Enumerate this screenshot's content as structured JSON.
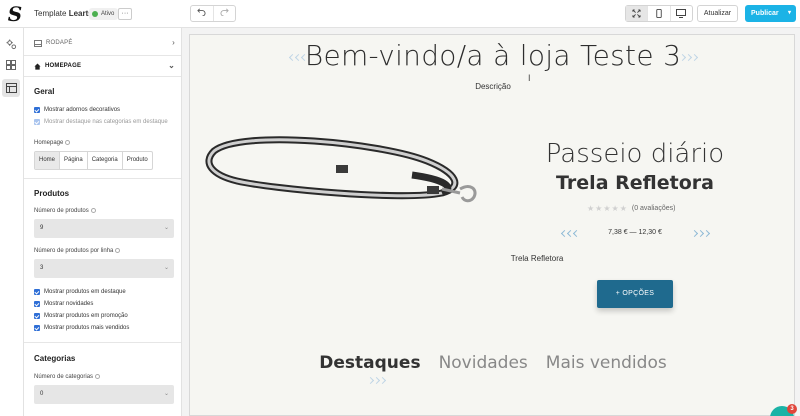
{
  "topbar": {
    "template_prefix": "Template",
    "template_name": "Learts",
    "status": "Ativo",
    "more": "···",
    "undo_icon": "undo-icon",
    "redo_icon": "redo-icon",
    "devices": [
      "fullscreen-icon",
      "mobile-icon",
      "desktop-icon"
    ],
    "update_label": "Atualizar",
    "publish_label": "Publicar",
    "publish_caret": "▾",
    "status_color": "#4caf50",
    "publish_color": "#1bb3e6"
  },
  "rail": [
    "settings-icon",
    "layout-icon",
    "sections-icon"
  ],
  "sidebar": {
    "footer_section": "Rodapé",
    "homepage_section": "Homepage",
    "geral": {
      "title": "Geral",
      "checks": [
        "Mostrar adornos decorativos",
        "Mostrar destaque nas categorias em destaque"
      ],
      "homepage_label": "Homepage",
      "homepage_options": [
        "Home",
        "Página",
        "Categoria",
        "Produto"
      ],
      "homepage_selected": "Home"
    },
    "produtos": {
      "title": "Produtos",
      "count_label": "Número de produtos",
      "count_value": "9",
      "per_line_label": "Número de produtos por linha",
      "per_line_value": "3",
      "checks": [
        "Mostrar produtos em destaque",
        "Mostrar novidades",
        "Mostrar produtos em promoção",
        "Mostrar produtos mais vendidos"
      ]
    },
    "categorias": {
      "title": "Categorias",
      "count_label": "Número de categorias",
      "count_value": "0"
    }
  },
  "preview": {
    "hero_title": "Bem-vindo/a à loja Teste 3",
    "hero_description": "Descrição",
    "product": {
      "category": "Passeio diário",
      "name": "Trela Refletora",
      "reviews": "(0 avaliações)",
      "rating": 0,
      "price": "7,38 € — 12,30 €",
      "description": "Trela Refletora",
      "options_button": "+ OPÇÕES"
    },
    "tabs": [
      "Destaques",
      "Novidades",
      "Mais vendidos"
    ],
    "accent": "#1f6a8e"
  },
  "chat_badge": "3"
}
